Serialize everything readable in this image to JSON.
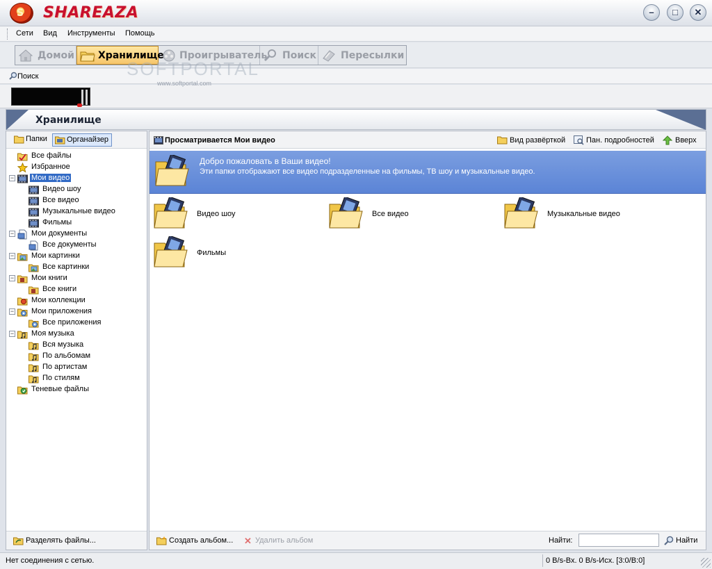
{
  "app": {
    "title": "SHAREAZA",
    "logo_letter": "S",
    "window_buttons": [
      "–",
      "□",
      "✕"
    ]
  },
  "menu": [
    "Сети",
    "Вид",
    "Инструменты",
    "Помощь"
  ],
  "nav_tabs": [
    {
      "label": "Домой",
      "icon": "home-icon",
      "active": false
    },
    {
      "label": "Хранилище",
      "icon": "folder-icon",
      "active": true
    },
    {
      "label": "Проигрыватель",
      "icon": "film-reel-icon",
      "active": false
    },
    {
      "label": "Поиск",
      "icon": "search-icon",
      "active": false
    },
    {
      "label": "Пересылки",
      "icon": "transfers-icon",
      "active": false
    }
  ],
  "search_link": "Поиск",
  "watermark": {
    "text": "SOFTPORTAL",
    "url": "www.softportal.com"
  },
  "section_title": "Хранилище",
  "left_tabs": [
    {
      "label": "Папки",
      "active": false
    },
    {
      "label": "Органайзер",
      "active": true
    }
  ],
  "tree": [
    {
      "label": "Все файлы",
      "level": 0,
      "icon": "all-files-icon"
    },
    {
      "label": "Избранное",
      "level": 0,
      "icon": "star-icon"
    },
    {
      "label": "Мои видео",
      "level": 0,
      "icon": "film-icon",
      "expanded": true,
      "selected": true
    },
    {
      "label": "Видео шоу",
      "level": 1,
      "icon": "film-icon"
    },
    {
      "label": "Все видео",
      "level": 1,
      "icon": "film-icon"
    },
    {
      "label": "Музыкальные видео",
      "level": 1,
      "icon": "film-icon"
    },
    {
      "label": "Фильмы",
      "level": 1,
      "icon": "film-icon"
    },
    {
      "label": "Мои документы",
      "level": 0,
      "icon": "document-icon",
      "expanded": true
    },
    {
      "label": "Все документы",
      "level": 1,
      "icon": "document-icon"
    },
    {
      "label": "Мои картинки",
      "level": 0,
      "icon": "pictures-icon",
      "expanded": true
    },
    {
      "label": "Все картинки",
      "level": 1,
      "icon": "pictures-icon"
    },
    {
      "label": "Мои книги",
      "level": 0,
      "icon": "books-icon",
      "expanded": true
    },
    {
      "label": "Все книги",
      "level": 1,
      "icon": "books-icon"
    },
    {
      "label": "Мои коллекции",
      "level": 0,
      "icon": "collection-icon"
    },
    {
      "label": "Мои приложения",
      "level": 0,
      "icon": "applications-icon",
      "expanded": true
    },
    {
      "label": "Все приложения",
      "level": 1,
      "icon": "applications-icon"
    },
    {
      "label": "Моя музыка",
      "level": 0,
      "icon": "music-icon",
      "expanded": true
    },
    {
      "label": "Вся музыка",
      "level": 1,
      "icon": "music-icon"
    },
    {
      "label": "По альбомам",
      "level": 1,
      "icon": "music-icon"
    },
    {
      "label": "По артистам",
      "level": 1,
      "icon": "music-icon"
    },
    {
      "label": "По стилям",
      "level": 1,
      "icon": "music-icon"
    },
    {
      "label": "Теневые файлы",
      "level": 0,
      "icon": "ghost-files-icon"
    }
  ],
  "left_footer": {
    "share_label": "Разделять файлы..."
  },
  "right_toolbar": {
    "browsing": "Просматривается Мои видео",
    "view_expand": "Вид развёрткой",
    "detail_panel": "Пан. подробностей",
    "up": "Вверх"
  },
  "welcome": {
    "title": "Добро пожаловать в Ваши видео!",
    "subtitle": "Эти папки отображают все видео подразделенные на фильмы, ТВ шоу и музыкальные видео."
  },
  "folders": [
    "Видео шоу",
    "Все видео",
    "Музыкальные видео",
    "Фильмы"
  ],
  "right_footer": {
    "create_album": "Создать альбом...",
    "delete_album": "Удалить альбом",
    "find_label": "Найти:",
    "find_value": "",
    "find_button": "Найти"
  },
  "status": {
    "text": "Нет соединения с сетью.",
    "rate": "0 B/s-Вх. 0 B/s-Исх. [3:0/B:0]"
  },
  "colors": {
    "brand_red": "#c8102e",
    "selection": "#316ac5",
    "welcome_banner": "#6b91db",
    "active_tab": "#f6c66b"
  }
}
